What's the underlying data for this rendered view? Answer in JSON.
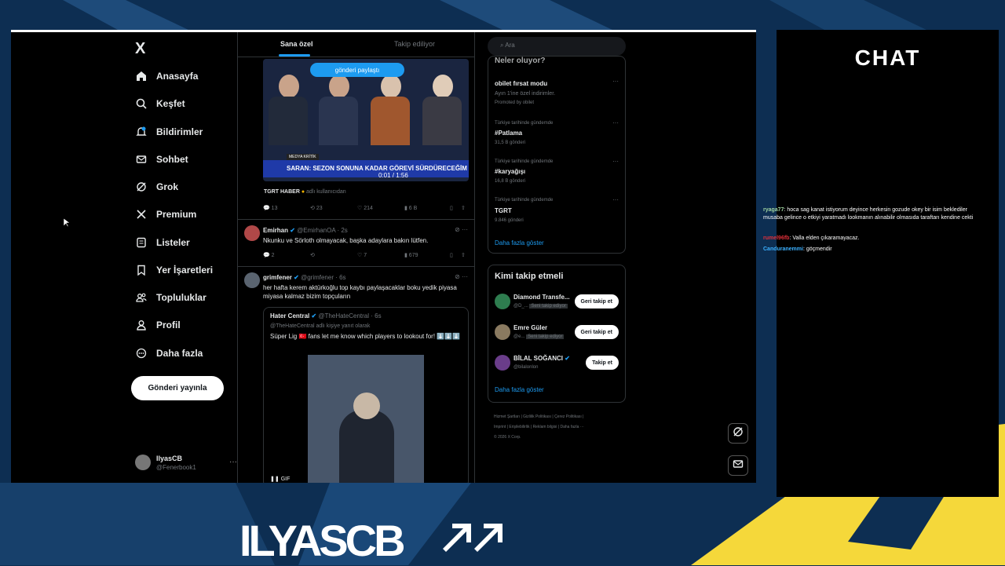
{
  "sidebar": {
    "logo": "X",
    "items": [
      {
        "label": "Anasayfa",
        "icon": "home-icon"
      },
      {
        "label": "Keşfet",
        "icon": "search-icon"
      },
      {
        "label": "Bildirimler",
        "icon": "bell-icon"
      },
      {
        "label": "Sohbet",
        "icon": "mail-icon"
      },
      {
        "label": "Grok",
        "icon": "grok-icon"
      },
      {
        "label": "Premium",
        "icon": "x-premium-icon"
      },
      {
        "label": "Listeler",
        "icon": "list-icon"
      },
      {
        "label": "Yer İşaretleri",
        "icon": "bookmark-icon"
      },
      {
        "label": "Topluluklar",
        "icon": "people-icon"
      },
      {
        "label": "Profil",
        "icon": "user-icon"
      },
      {
        "label": "Daha fazla",
        "icon": "more-circle-icon"
      }
    ],
    "post_button": "Gönderi yayınla",
    "profile": {
      "name": "IlyasCB",
      "handle": "@Fenerbook1",
      "more": "···"
    }
  },
  "feed": {
    "tabs": [
      "Sana özel",
      "Takip ediliyor"
    ],
    "video": {
      "pill": "gönderi paylaştı",
      "banner": "SARAN: SEZON SONUNA KADAR GÖREVİ SÜRDÜRECEĞİM",
      "tag": "MEDYA KRİTİK",
      "time": "0:01 / 1:56"
    },
    "video_source": {
      "name": "TGRT HABER",
      "suffix": "adlı kullanıcıdan"
    },
    "video_actions": {
      "replies": "13",
      "reposts": "23",
      "likes": "214",
      "views": "6 B"
    },
    "posts": [
      {
        "author": "Emirhan",
        "handle": "@EmirhanOA · 2s",
        "text": "Nkunku ve Sörloth olmayacak, başka adaylara bakın lütfen.",
        "replies": "2",
        "likes": "7",
        "views": "679"
      },
      {
        "author": "grimfener",
        "handle": "@grimfener · 6s",
        "text": "her hafta kerem aktürkoğlu top kaybı paylaşacaklar boku yedik piyasa miyasa kalmaz bizim topçuların"
      }
    ],
    "quote": {
      "author": "Hater Central",
      "handle": "@TheHateCentral · 6s",
      "reply_to": "@TheHateCentral adlı kişiye yanıt olarak",
      "text": "Süper Lig 🇹🇷 fans let me know which players to lookout for! ⬇️⬇️⬇️",
      "gif": "GIF"
    }
  },
  "right": {
    "search_placeholder": "Ara",
    "whats_happening": "Neler oluyor?",
    "trends": [
      {
        "cat": "",
        "name": "obilet fırsat modu",
        "count": "Ayın 1'ine özel indirimler.",
        "promo": "Promoted by obilet"
      },
      {
        "cat": "Türkiye tarihinde gündemde",
        "name": "#Patlama",
        "count": "31,5 B gönderi"
      },
      {
        "cat": "Türkiye tarihinde gündemde",
        "name": "#karyağışı",
        "count": "16,8 B gönderi"
      },
      {
        "cat": "Türkiye tarihinde gündemde",
        "name": "TGRT",
        "count": "9.846 gönderi"
      }
    ],
    "show_more": "Daha fazla göster",
    "who_to_follow": "Kimi takip etmeli",
    "suggestions": [
      {
        "name": "Diamond Transfe...",
        "handle": "@D_...",
        "badge": "Seni takip ediyor",
        "button": "Geri takip et",
        "color": "#2e7d4f"
      },
      {
        "name": "Emre Güler",
        "handle": "@e...",
        "badge": "Seni takip ediyor",
        "button": "Geri takip et",
        "color": "#8a7a60"
      },
      {
        "name": "BİLAL SOĞANCI",
        "handle": "@bilalonlon",
        "badge": "",
        "button": "Takip et",
        "color": "#6a3d8a"
      }
    ],
    "show_more_2": "Daha fazla göster",
    "footer": [
      "Hizmet Şartları",
      "Gizlilik Politikası",
      "Çerez Politikası",
      "Imprint",
      "Erişilebilirlik",
      "Reklam bilgisi",
      "Daha fazla ···",
      "© 2026 X Corp."
    ]
  },
  "chat": {
    "title": "CHAT",
    "messages": [
      {
        "user": "ryaga77",
        "text": ": hoca sag kanat istiyorum deyince herkesin gozude okey bir isim beklediler musaba gelince o etkiyi yaratmadı lookmanın alınabilir olmasıda taraftarı kendine cekti",
        "color": "#9fd3a0"
      },
      {
        "user": "rumel96fb",
        "text": ": Valla elden çıkaramayacaz.",
        "color": "#e0303a"
      },
      {
        "user": "Canduranemmi",
        "text": ": göçmendir",
        "color": "#3bb0ff"
      }
    ]
  },
  "overlay": {
    "brand": "ILYASCB"
  },
  "colors": {
    "accent": "#1d9bf0",
    "brand_blue": "#0d2e52",
    "brand_yellow": "#f5d83a"
  }
}
